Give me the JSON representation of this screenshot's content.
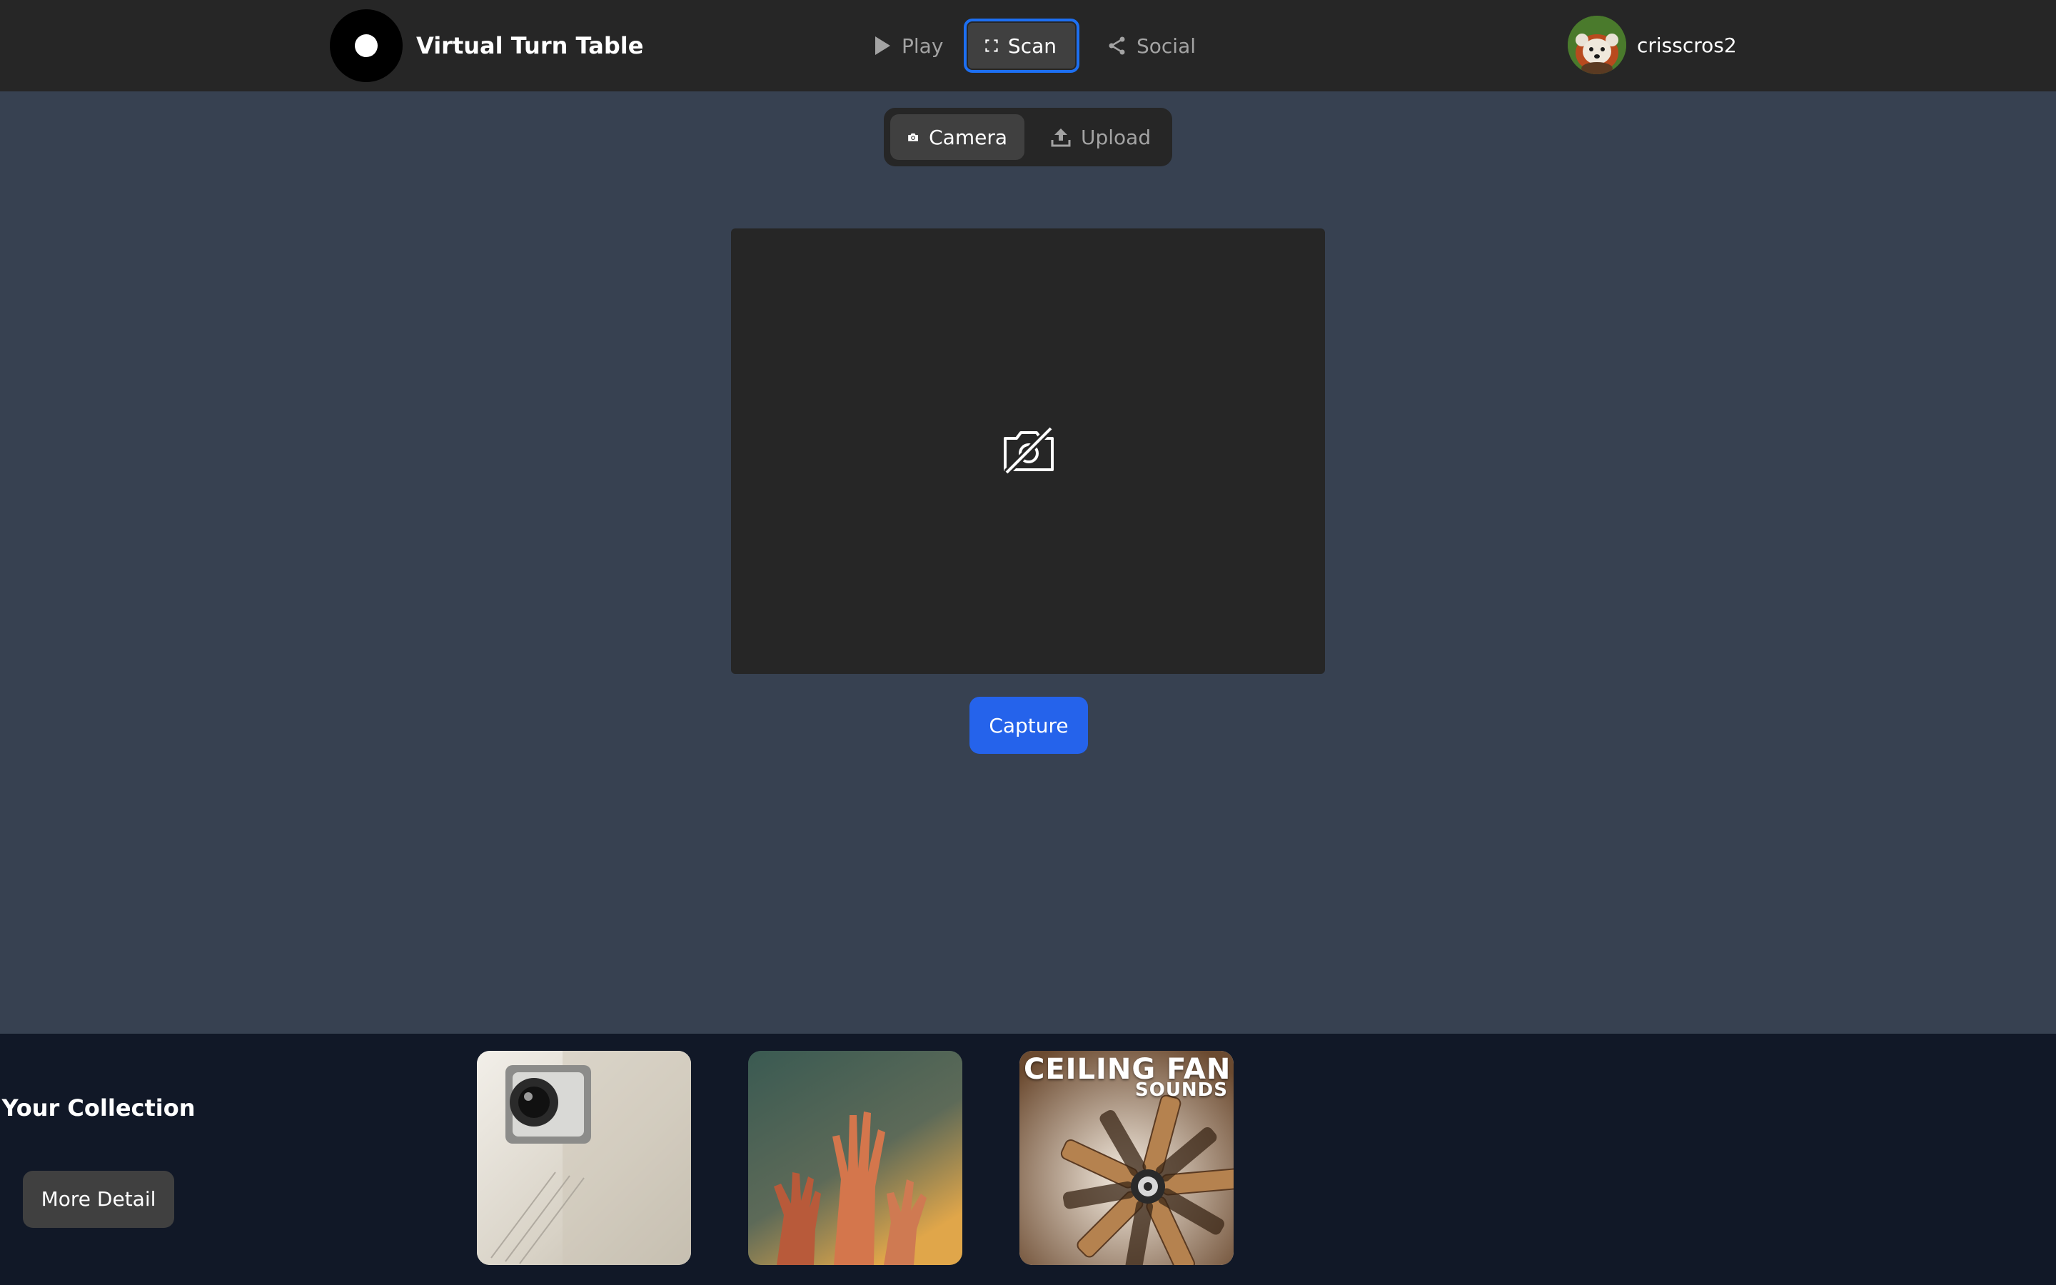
{
  "app": {
    "title": "Virtual Turn Table",
    "logo_icon": "vinyl-record-icon"
  },
  "nav": {
    "items": [
      {
        "label": "Play",
        "icon": "play-icon",
        "active": false
      },
      {
        "label": "Scan",
        "icon": "scan-frame-icon",
        "active": true
      },
      {
        "label": "Social",
        "icon": "share-icon",
        "active": false
      }
    ]
  },
  "user": {
    "name": "crisscros2",
    "avatar_icon": "red-panda-avatar"
  },
  "source": {
    "options": [
      {
        "label": "Camera",
        "icon": "camera-icon",
        "selected": true
      },
      {
        "label": "Upload",
        "icon": "upload-icon",
        "selected": false
      }
    ]
  },
  "viewport": {
    "status_icon": "camera-off-icon"
  },
  "capture": {
    "label": "Capture"
  },
  "collection": {
    "title": "Your Collection",
    "more_label": "More Detail",
    "albums": [
      {
        "cover": "disco-ball-album-cover",
        "caption": ""
      },
      {
        "cover": "raised-hands-album-cover",
        "caption": ""
      },
      {
        "cover": "ceiling-fan-album-cover",
        "title_line_1": "CEILING FAN",
        "title_line_2": "SOUNDS"
      }
    ]
  },
  "colors": {
    "topbar": "#262626",
    "page_bg": "#374151",
    "collection_bg": "#111827",
    "accent": "#2563eb",
    "active_outline": "#1d6ff2"
  }
}
